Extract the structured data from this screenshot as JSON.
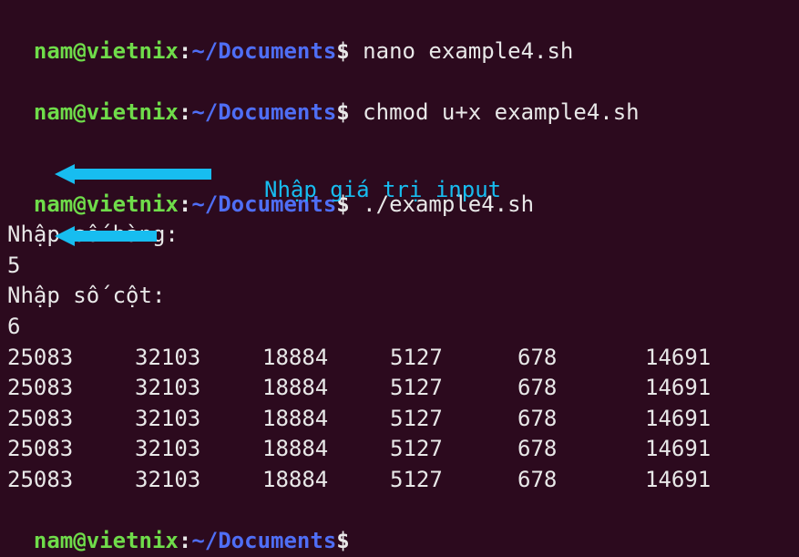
{
  "prompt": {
    "user": "nam",
    "at": "@",
    "host": "vietnix",
    "sep": ":",
    "path": "~/Documents",
    "dollar": "$"
  },
  "commands": {
    "c1": " nano example4.sh",
    "c2": " chmod u+x example4.sh",
    "c3": " ./example4.sh",
    "c4": ""
  },
  "io": {
    "prompt_rows": "Nhập sô´hàng:",
    "input_rows": "5",
    "prompt_cols": "Nhập sô´cột:",
    "input_cols": "6"
  },
  "annotation": {
    "label": "Nhập giá trị input"
  },
  "table": {
    "rows": [
      [
        "25083",
        "32103",
        "18884",
        "5127",
        "678",
        "14691"
      ],
      [
        "25083",
        "32103",
        "18884",
        "5127",
        "678",
        "14691"
      ],
      [
        "25083",
        "32103",
        "18884",
        "5127",
        "678",
        "14691"
      ],
      [
        "25083",
        "32103",
        "18884",
        "5127",
        "678",
        "14691"
      ],
      [
        "25083",
        "32103",
        "18884",
        "5127",
        "678",
        "14691"
      ]
    ]
  }
}
